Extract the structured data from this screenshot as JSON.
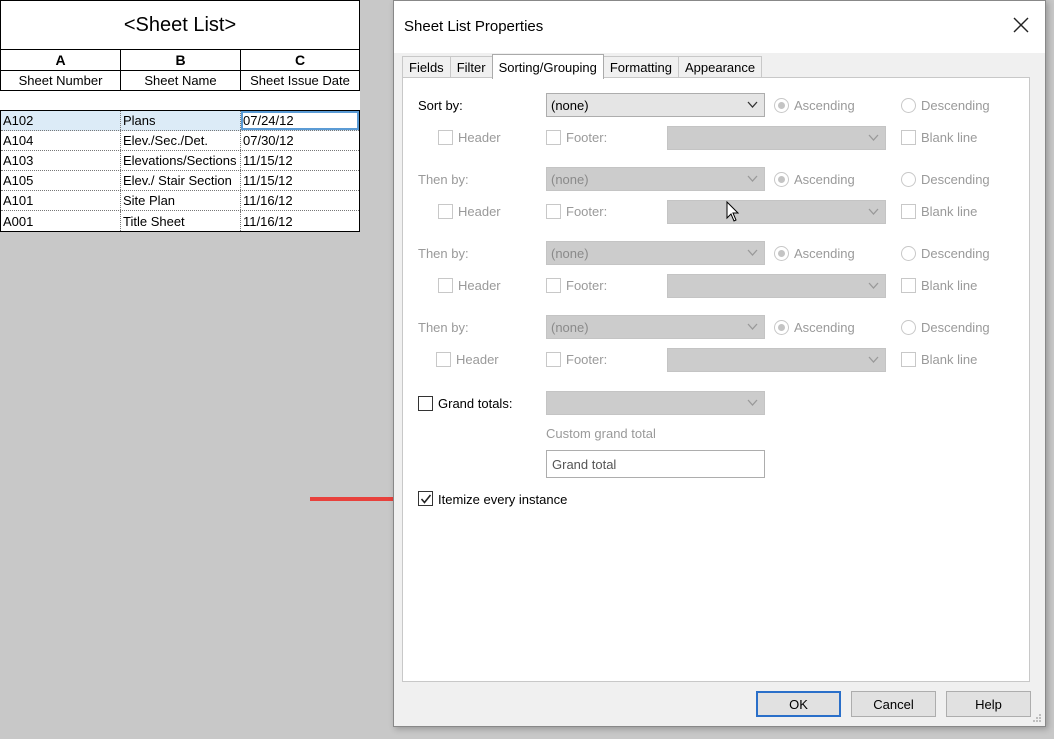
{
  "schedule": {
    "title": "<Sheet List>",
    "col_letters": [
      "A",
      "B",
      "C"
    ],
    "col_headers": [
      "Sheet Number",
      "Sheet Name",
      "Sheet Issue Date"
    ],
    "rows": [
      [
        "A102",
        "Plans",
        "07/24/12"
      ],
      [
        "A104",
        "Elev./Sec./Det.",
        "07/30/12"
      ],
      [
        "A103",
        "Elevations/Sections",
        "11/15/12"
      ],
      [
        "A105",
        "Elev./ Stair Section",
        "11/15/12"
      ],
      [
        "A101",
        "Site Plan",
        "11/16/12"
      ],
      [
        "A001",
        "Title Sheet",
        "11/16/12"
      ]
    ],
    "selected_row": 0
  },
  "dialog": {
    "title": "Sheet List Properties",
    "close_icon": "close-icon",
    "tabs": [
      "Fields",
      "Filter",
      "Sorting/Grouping",
      "Formatting",
      "Appearance"
    ],
    "active_tab": "Sorting/Grouping",
    "sort_groups": [
      {
        "label": "Sort by:",
        "value": "(none)",
        "ascending": "Ascending",
        "descending": "Descending",
        "header": "Header",
        "footer": "Footer:",
        "blank_line": "Blank line"
      },
      {
        "label": "Then by:",
        "value": "(none)",
        "ascending": "Ascending",
        "descending": "Descending",
        "header": "Header",
        "footer": "Footer:",
        "blank_line": "Blank line"
      },
      {
        "label": "Then by:",
        "value": "(none)",
        "ascending": "Ascending",
        "descending": "Descending",
        "header": "Header",
        "footer": "Footer:",
        "blank_line": "Blank line"
      },
      {
        "label": "Then by:",
        "value": "(none)",
        "ascending": "Ascending",
        "descending": "Descending",
        "header": "Header",
        "footer": "Footer:",
        "blank_line": "Blank line"
      }
    ],
    "grand_totals": {
      "label": "Grand totals:",
      "checked": false
    },
    "custom_grand_total": {
      "label": "Custom grand total",
      "value": "Grand total"
    },
    "itemize": {
      "label": "Itemize every instance",
      "checked": true
    },
    "buttons": {
      "ok": "OK",
      "cancel": "Cancel",
      "help": "Help"
    }
  },
  "colors": {
    "arrow": "#e8413c",
    "selection": "#dcebf7",
    "default_button_border": "#2a6fc9"
  }
}
